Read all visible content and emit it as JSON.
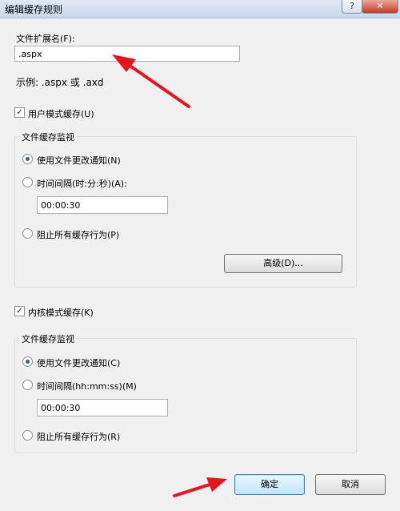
{
  "window": {
    "title": "编辑缓存规则",
    "help_label": "?",
    "close_label": "✕"
  },
  "extension": {
    "label": "文件扩展名(F):",
    "value": ".aspx",
    "example": "示例: .aspx 或 .axd"
  },
  "user_mode": {
    "checkbox_label": "用户模式缓存(U)",
    "checked": true,
    "group_title": "文件缓存监视",
    "option_notify": "使用文件更改通知(N)",
    "option_interval": "时间间隔(时:分:秒)(A):",
    "interval_value": "00:00:30",
    "option_prevent": "阻止所有缓存行为(P)",
    "selected": "notify",
    "advanced_button": "高级(D)..."
  },
  "kernel_mode": {
    "checkbox_label": "内核模式缓存(K)",
    "checked": true,
    "group_title": "文件缓存监视",
    "option_notify": "使用文件更改通知(C)",
    "option_interval": "时间间隔(hh:mm:ss)(M)",
    "interval_value": "00:00:30",
    "option_prevent": "阻止所有缓存行为(R)",
    "selected": "notify"
  },
  "footer": {
    "ok_button": "确定",
    "cancel_button": "取消"
  },
  "colors": {
    "annotation_arrow": "#e8141b",
    "default_button_border": "#3c7fb1"
  }
}
